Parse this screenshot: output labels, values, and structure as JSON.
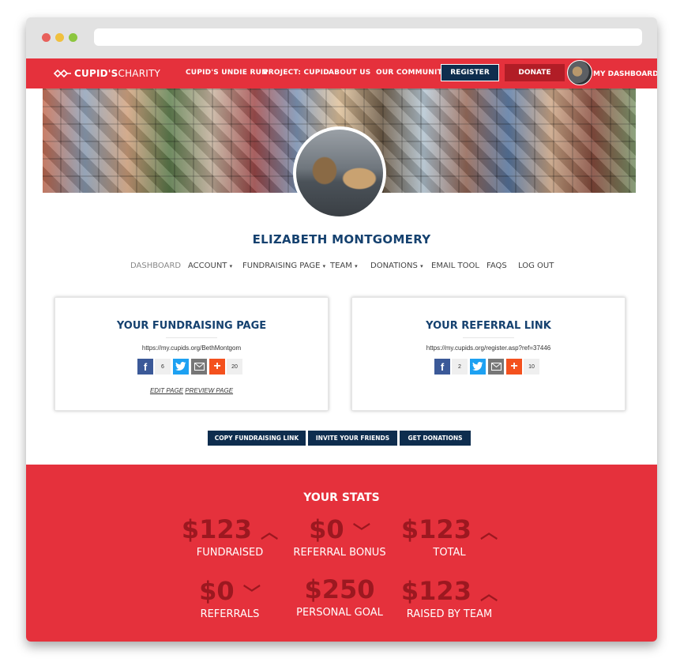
{
  "nav": {
    "logo_bold": "CUPID'S",
    "logo_light": "CHARITY",
    "links": [
      "CUPID'S UNDIE RUN",
      "PROJECT: CUPID",
      "ABOUT US",
      "OUR COMMUNITY"
    ],
    "register": "REGISTER",
    "donate": "DONATE",
    "dashboard": "MY DASHBOARD"
  },
  "profile": {
    "name": "ELIZABETH MONTGOMERY"
  },
  "subnav": [
    "DASHBOARD",
    "ACCOUNT",
    "FUNDRAISING PAGE",
    "TEAM",
    "DONATIONS",
    "EMAIL TOOL",
    "FAQS",
    "LOG OUT"
  ],
  "fundraising_card": {
    "title": "YOUR FUNDRAISING PAGE",
    "url": "https://my.cupids.org/BethMontgom",
    "facebook_count": "6",
    "plus_count": "20",
    "edit_link": "EDIT PAGE",
    "preview_link": "PREVIEW PAGE"
  },
  "referral_card": {
    "title": "YOUR REFERRAL LINK",
    "url": "https://my.cupids.org/register.asp?ref=37446",
    "facebook_count": "2",
    "plus_count": "10"
  },
  "actions": [
    "COPY FUNDRAISING LINK",
    "INVITE YOUR FRIENDS",
    "GET DONATIONS"
  ],
  "stats": {
    "title": "YOUR STATS",
    "items": [
      {
        "value": "$123",
        "label": "FUNDRAISED",
        "trend": "up"
      },
      {
        "value": "$0",
        "label": "REFERRAL BONUS",
        "trend": "down"
      },
      {
        "value": "$123",
        "label": "TOTAL",
        "trend": "up"
      },
      {
        "value": "$0",
        "label": "REFERRALS",
        "trend": "down"
      },
      {
        "value": "$250",
        "label": "PERSONAL GOAL",
        "trend": "none"
      },
      {
        "value": "$123",
        "label": "RAISED BY TEAM",
        "trend": "up"
      }
    ]
  },
  "colors": {
    "brand_red": "#e5313c",
    "navy": "#0e2d4e",
    "heading_blue": "#15416f",
    "stat_value": "#9c1820"
  }
}
